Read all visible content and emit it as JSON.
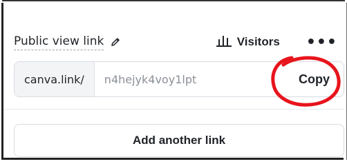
{
  "share": {
    "link_label": "Public view link",
    "visitors_label": "Visitors",
    "more_label": "•••",
    "domain": "canva.link/",
    "slug": "n4hejyk4voy1lpt",
    "copy_label": "Copy",
    "add_link_label": "Add another link"
  },
  "icons": {
    "edit": "pencil-icon",
    "visitors": "bar-chart-icon",
    "more": "more-horizontal-icon"
  },
  "colors": {
    "annotation_circle": "#e8141c",
    "text": "#1f2328",
    "muted_text": "#8b9096",
    "domain_bg": "#f3f4f6",
    "border": "#d7dbe0"
  }
}
